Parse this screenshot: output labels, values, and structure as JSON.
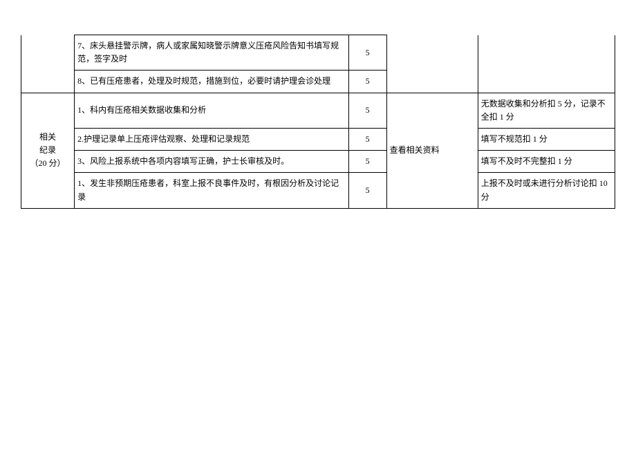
{
  "rows": {
    "r7": {
      "desc": "7、床头悬挂警示牌，病人或家属知晓警示牌意义压疮风险告知书填写规范，签字及时",
      "score": "5"
    },
    "r8": {
      "desc": "8、已有压疮患者，处理及时规范，措施到位，必要时请护理会诊处理",
      "score": "5"
    },
    "cat2": {
      "label_line1": "相关",
      "label_line2": "纪录",
      "label_line3": "（20 分）",
      "method": "查看相关资料"
    },
    "s1": {
      "desc": "1、科内有压疮相关数据收集和分析",
      "score": "5",
      "remark": "无数据收集和分析扣 5 分，记录不全扣 1 分"
    },
    "s2": {
      "desc": "2.护理记录单上压疮评估观察、处理和记录规范",
      "score": "5",
      "remark": "填写不规范扣 1 分"
    },
    "s3": {
      "desc": "3、风险上报系统中各项内容填写正确，护士长审核及时。",
      "score": "5",
      "remark": "填写不及时不完整扣 1 分"
    },
    "s4": {
      "desc": "1、发生非预期压疮患者，科室上报不良事件及时，有根因分析及讨论记录",
      "score": "5",
      "remark": "上报不及时或未进行分析讨论扣 10 分"
    }
  }
}
